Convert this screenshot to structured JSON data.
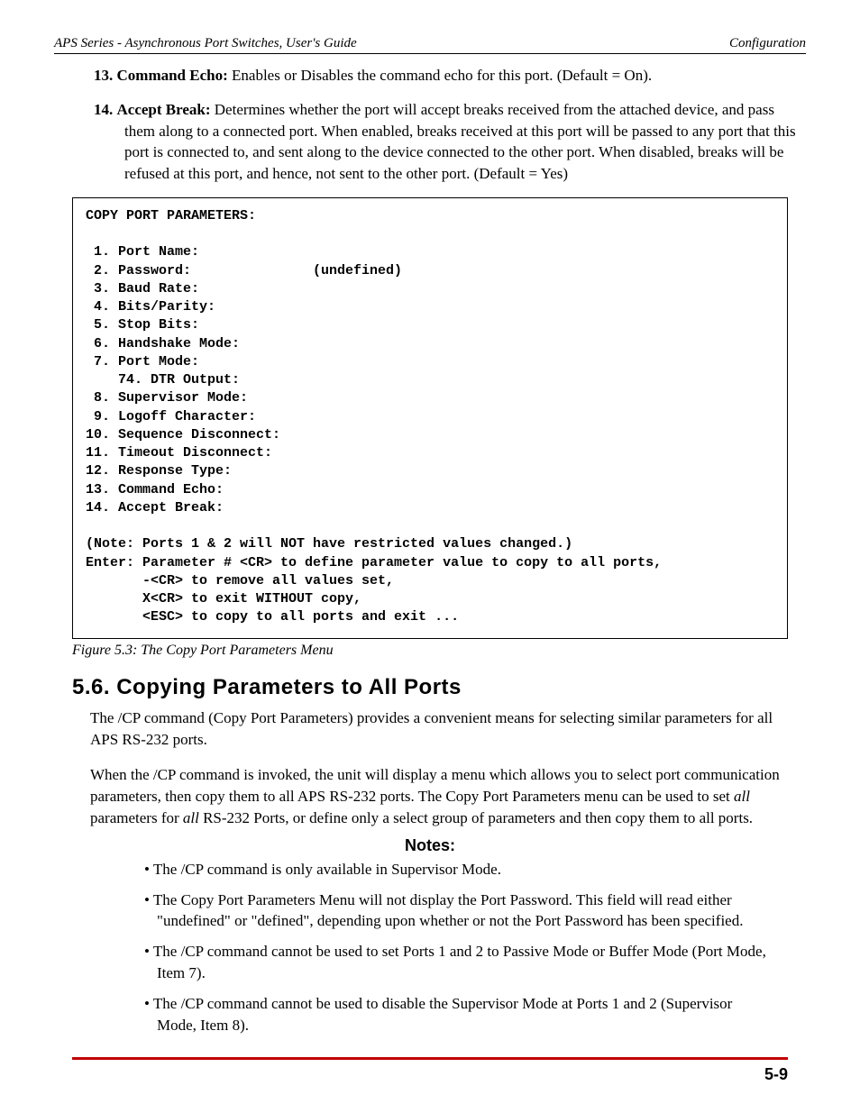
{
  "header": {
    "left": "APS Series - Asynchronous Port Switches, User's Guide",
    "right": "Configuration"
  },
  "list_items": {
    "i13": {
      "num": "13.",
      "term": "Command Echo:",
      "text": "  Enables or Disables the command echo for this port.  (Default = On)."
    },
    "i14": {
      "num": "14.",
      "term": "Accept Break:",
      "text": "  Determines whether the port will accept breaks received from the attached device, and pass them along to a connected port.  When enabled, breaks received at this port will be passed to any port that this port is connected to, and sent along to the device connected to the other port.  When disabled, breaks will be refused at this port, and hence, not sent to the other port.  (Default = Yes)"
    }
  },
  "figure": {
    "content": "COPY PORT PARAMETERS:\n\n 1. Port Name:\n 2. Password:               (undefined)\n 3. Baud Rate:\n 4. Bits/Parity:\n 5. Stop Bits:\n 6. Handshake Mode:\n 7. Port Mode:\n    74. DTR Output:\n 8. Supervisor Mode:\n 9. Logoff Character:\n10. Sequence Disconnect:\n11. Timeout Disconnect:\n12. Response Type:\n13. Command Echo:\n14. Accept Break:\n\n(Note: Ports 1 & 2 will NOT have restricted values changed.)\nEnter: Parameter # <CR> to define parameter value to copy to all ports,\n       -<CR> to remove all values set,\n       X<CR> to exit WITHOUT copy,\n       <ESC> to copy to all ports and exit ...",
    "caption": "Figure 5.3:  The Copy Port Parameters Menu"
  },
  "section": {
    "heading": "5.6.  Copying Parameters to All Ports",
    "p1": "The /CP command (Copy Port Parameters) provides a convenient means for selecting similar parameters for all APS RS-232 ports.",
    "p2a": "When the /CP command is invoked, the unit will display a menu which allows you to select port communication parameters, then copy them to all APS RS-232 ports.  The Copy Port Parameters menu can be used to set ",
    "p2b": "all",
    "p2c": " parameters for ",
    "p2d": "all",
    "p2e": " RS-232 Ports, or define only a select group of parameters and then copy them to all ports."
  },
  "notes": {
    "heading": "Notes:",
    "items": {
      "n1": "The /CP command is only available in Supervisor Mode.",
      "n2": "The Copy Port Parameters Menu will not display the Port Password.  This field will read either \"undefined\" or \"defined\", depending upon whether or not the Port Password has been specified.",
      "n3": "The /CP command cannot be used to set Ports 1 and 2 to Passive Mode or Buffer Mode (Port Mode, Item 7).",
      "n4": "The /CP command cannot be used to disable the Supervisor Mode at Ports 1 and 2 (Supervisor Mode, Item 8)."
    }
  },
  "page_number": "5-9"
}
